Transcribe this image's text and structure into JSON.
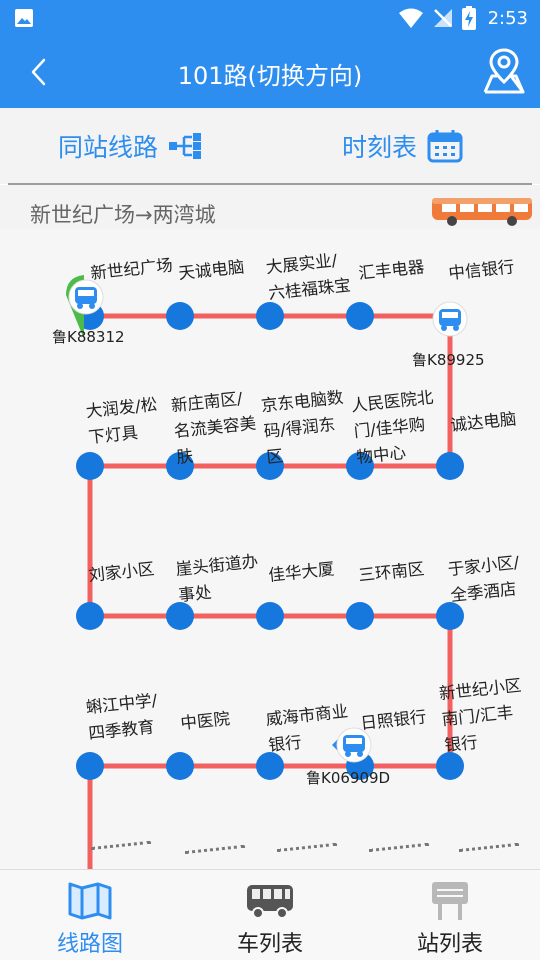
{
  "status_bar": {
    "time": "2:53"
  },
  "header": {
    "title": "101路(切换方向)"
  },
  "actions": {
    "same_stop_lines": "同站线路",
    "timetable": "时刻表"
  },
  "direction": {
    "text": "新世纪广场→两湾城"
  },
  "route": {
    "line_color": "#f26160",
    "stop_color": "#1677dc",
    "stops": [
      {
        "label": "新世纪广场"
      },
      {
        "label": "天诚电脑"
      },
      {
        "label": "大展实业/\n六桂福珠宝"
      },
      {
        "label": "汇丰电器"
      },
      {
        "label": "中信银行"
      },
      {
        "label": "诚达电脑"
      },
      {
        "label": "人民医院北\n门/佳华购\n物中心"
      },
      {
        "label": "京东电脑数\n码/得润东\n区"
      },
      {
        "label": "新庄南区/\n名流美容美\n肤"
      },
      {
        "label": "大润发/松\n下灯具"
      },
      {
        "label": "刘家小区"
      },
      {
        "label": "崖头街道办\n事处"
      },
      {
        "label": "佳华大厦"
      },
      {
        "label": "三环南区"
      },
      {
        "label": "于家小区/\n全季酒店"
      },
      {
        "label": "新世纪小区\n南门/汇丰\n银行"
      },
      {
        "label": "日照银行"
      },
      {
        "label": "威海市商业\n银行"
      },
      {
        "label": "中医院"
      },
      {
        "label": "蝌江中学/\n四季教育"
      }
    ],
    "buses": [
      {
        "plate": "鲁K88312"
      },
      {
        "plate": "鲁K89925"
      },
      {
        "plate": "鲁K06909D"
      }
    ]
  },
  "tabs": [
    {
      "label": "线路图",
      "active": true
    },
    {
      "label": "车列表",
      "active": false
    },
    {
      "label": "站列表",
      "active": false
    }
  ]
}
